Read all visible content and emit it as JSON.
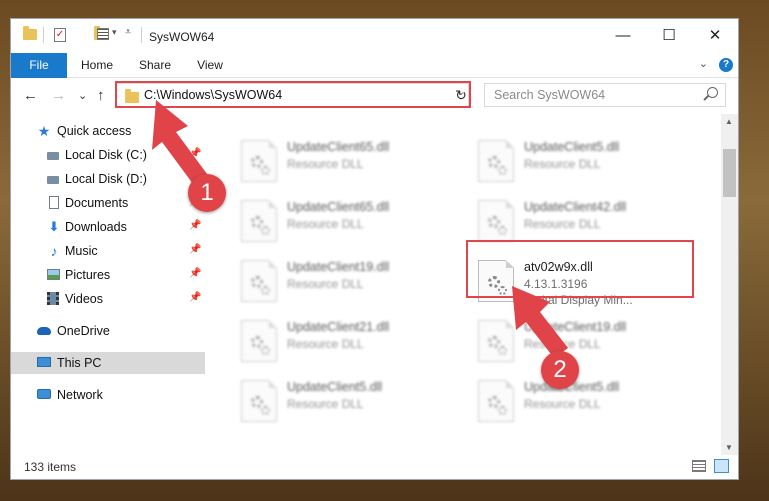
{
  "window": {
    "title": "SysWOW64",
    "minimize_symbol": "—",
    "maximize_symbol": "☐",
    "close_symbol": "✕"
  },
  "ribbon": {
    "tabs": [
      "File",
      "Home",
      "Share",
      "View"
    ],
    "help_symbol": "?",
    "collapse_symbol": "⌄"
  },
  "nav": {
    "back_symbol": "←",
    "forward_symbol": "→",
    "recent_symbol": "⌄",
    "up_symbol": "↑",
    "address": "C:\\Windows\\SysWOW64",
    "address_dropdown_symbol": "⌄",
    "refresh_symbol": "↻",
    "search_placeholder": "Search SysWOW64"
  },
  "sidebar": {
    "pin_symbol": "📌",
    "items": [
      {
        "label": "Quick access",
        "icon": "star-icon"
      },
      {
        "label": "Local Disk (C:)",
        "icon": "drive-icon",
        "pinned": true
      },
      {
        "label": "Local Disk (D:)",
        "icon": "drive-icon",
        "pinned": true
      },
      {
        "label": "Documents",
        "icon": "documents-icon",
        "pinned": true
      },
      {
        "label": "Downloads",
        "icon": "downloads-icon",
        "pinned": true
      },
      {
        "label": "Music",
        "icon": "music-icon",
        "pinned": true
      },
      {
        "label": "Pictures",
        "icon": "pictures-icon",
        "pinned": true
      },
      {
        "label": "Videos",
        "icon": "videos-icon",
        "pinned": true
      },
      {
        "label": "OneDrive",
        "icon": "onedrive-icon"
      },
      {
        "label": "This PC",
        "icon": "this-pc-icon",
        "selected": true
      },
      {
        "label": "Network",
        "icon": "network-icon"
      }
    ]
  },
  "files": [
    {
      "name": "UpdateClient65.dll",
      "type": "Resource DLL"
    },
    {
      "name": "UpdateClient5.dll",
      "type": "Resource DLL"
    },
    {
      "name": "UpdateClient65.dll",
      "type": "Resource DLL"
    },
    {
      "name": "UpdateClient42.dll",
      "type": "Resource DLL"
    },
    {
      "name": "UpdateClient19.dll",
      "type": "Resource DLL"
    },
    {
      "name": "atv02w9x.dll",
      "version": "4.13.1.3196",
      "description": "Digital Display Min...",
      "highlighted": true
    },
    {
      "name": "UpdateClient21.dll",
      "type": "Resource DLL"
    },
    {
      "name": "UpdateClient19.dll",
      "type": "Resource DLL"
    },
    {
      "name": "UpdateClient5.dll",
      "type": "Resource DLL"
    },
    {
      "name": "UpdateClient5.dll",
      "type": "Resource DLL"
    }
  ],
  "status": {
    "item_count": "133 items"
  },
  "annotations": {
    "step1": "1",
    "step2": "2",
    "highlight_color": "#e0474c"
  },
  "colors": {
    "accent": "#1979ca",
    "selection": "#d9d9d9"
  }
}
